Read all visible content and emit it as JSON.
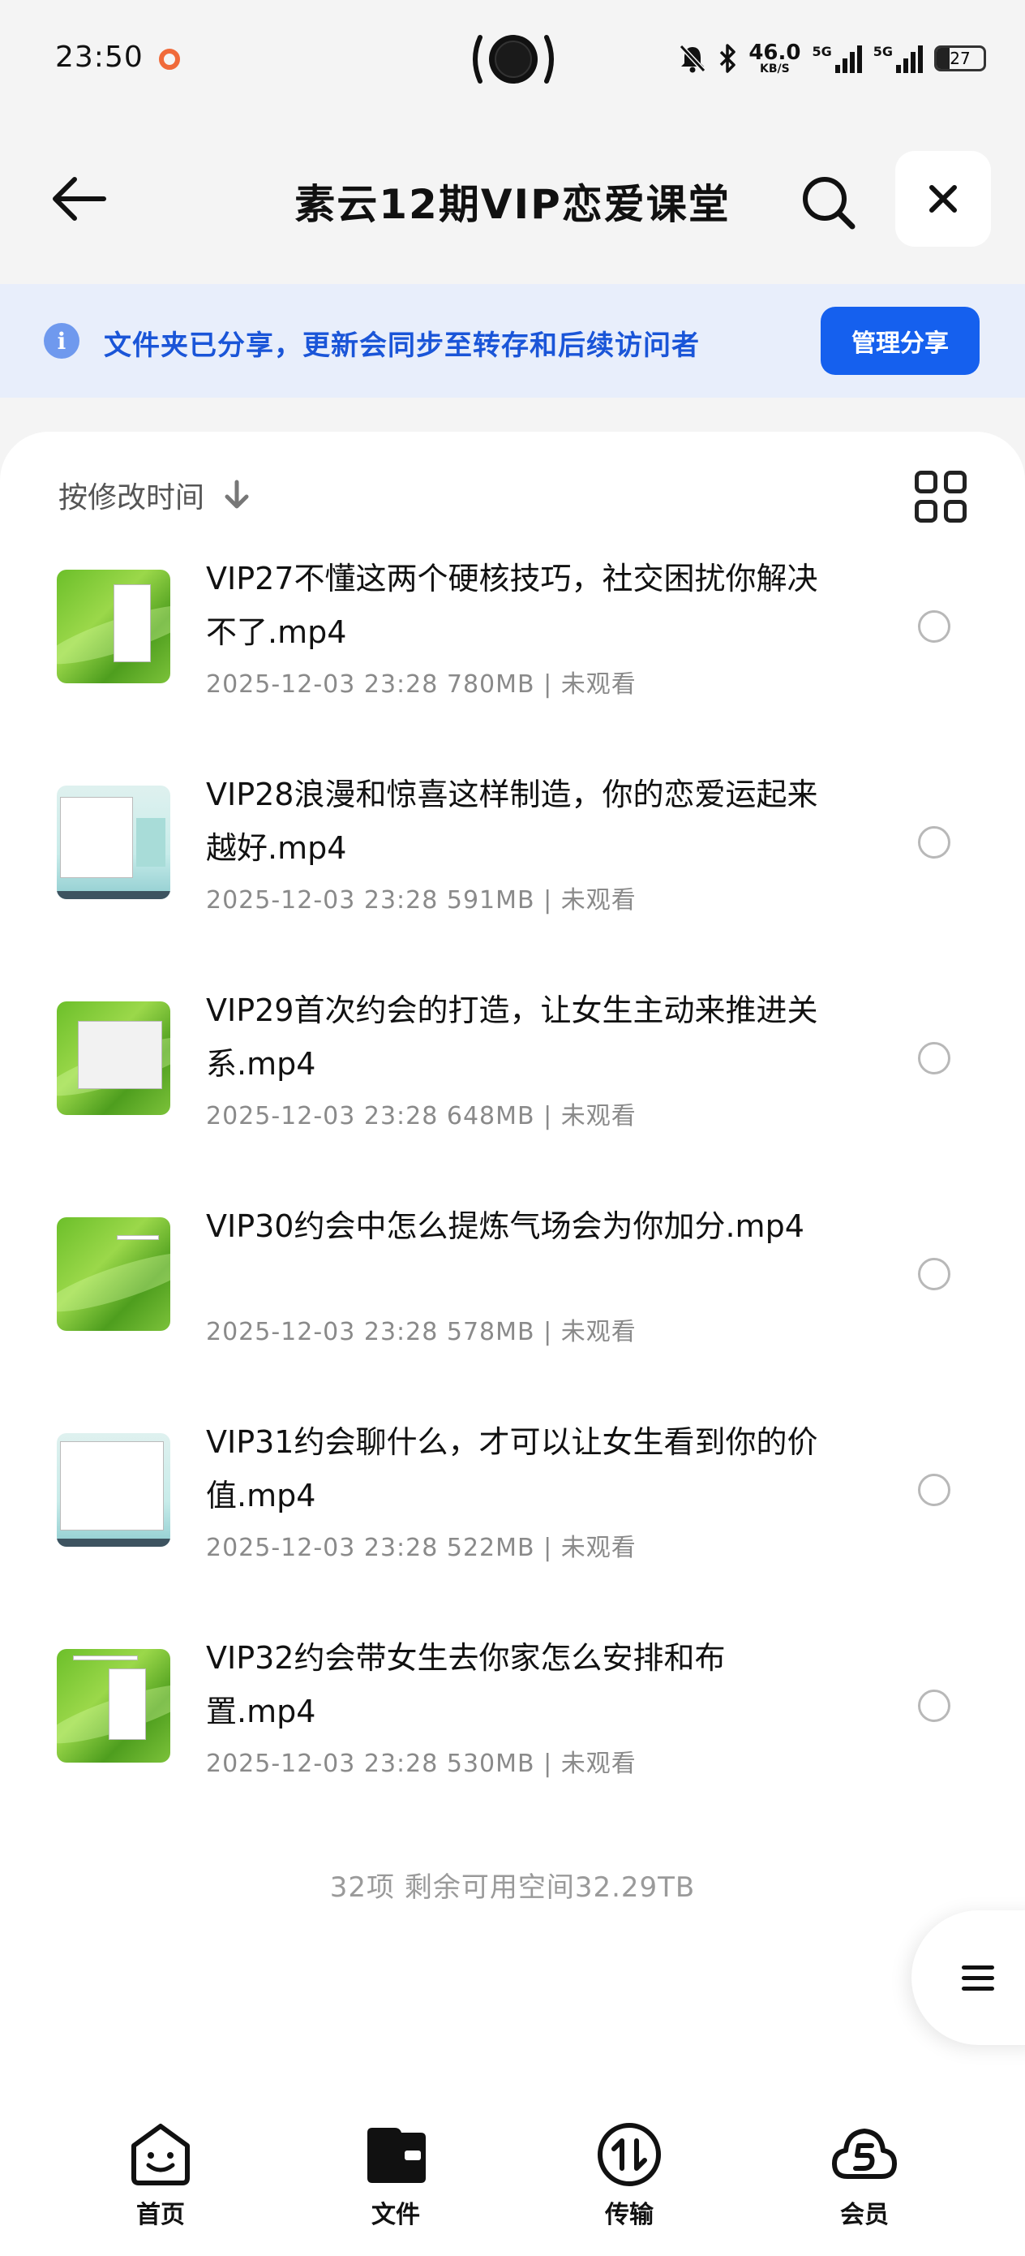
{
  "status_bar": {
    "time": "23:50",
    "net_speed": "46.0",
    "net_unit": "KB/S",
    "sim1": "5G",
    "sim2": "5G",
    "battery": "27"
  },
  "header": {
    "title": "素云12期VIP恋爱课堂",
    "back_icon": "arrow-left-icon",
    "search_icon": "search-icon",
    "close_icon": "close-icon"
  },
  "banner": {
    "text": "文件夹已分享，更新会同步至转存和后续访问者",
    "button": "管理分享",
    "accent": "#1560ee"
  },
  "list": {
    "sort_label": "按修改时间",
    "items": [
      {
        "name": "VIP27不懂这两个硬核技巧，社交困扰你解决不了.mp4",
        "meta": "2025-12-03 23:28  780MB | 未观看",
        "thumb": "green"
      },
      {
        "name": "VIP28浪漫和惊喜这样制造，你的恋爱运起来越好.mp4",
        "meta": "2025-12-03 23:28  591MB | 未观看",
        "thumb": "desk"
      },
      {
        "name": "VIP29首次约会的打造，让女生主动来推进关系.mp4",
        "meta": "2025-12-03 23:28  648MB | 未观看",
        "thumb": "green"
      },
      {
        "name": "VIP30约会中怎么提炼气场会为你加分.mp4",
        "meta": "2025-12-03 23:28  578MB | 未观看",
        "thumb": "green"
      },
      {
        "name": "VIP31约会聊什么，才可以让女生看到你的价值.mp4",
        "meta": "2025-12-03 23:28  522MB | 未观看",
        "thumb": "desk"
      },
      {
        "name": "VIP32约会带女生去你家怎么安排和布置.mp4",
        "meta": "2025-12-03 23:28  530MB | 未观看",
        "thumb": "green"
      }
    ],
    "summary": "32项 剩余可用空间32.29TB"
  },
  "bottom_nav": {
    "home": "首页",
    "files": "文件",
    "transfer": "传输",
    "vip": "会员"
  }
}
